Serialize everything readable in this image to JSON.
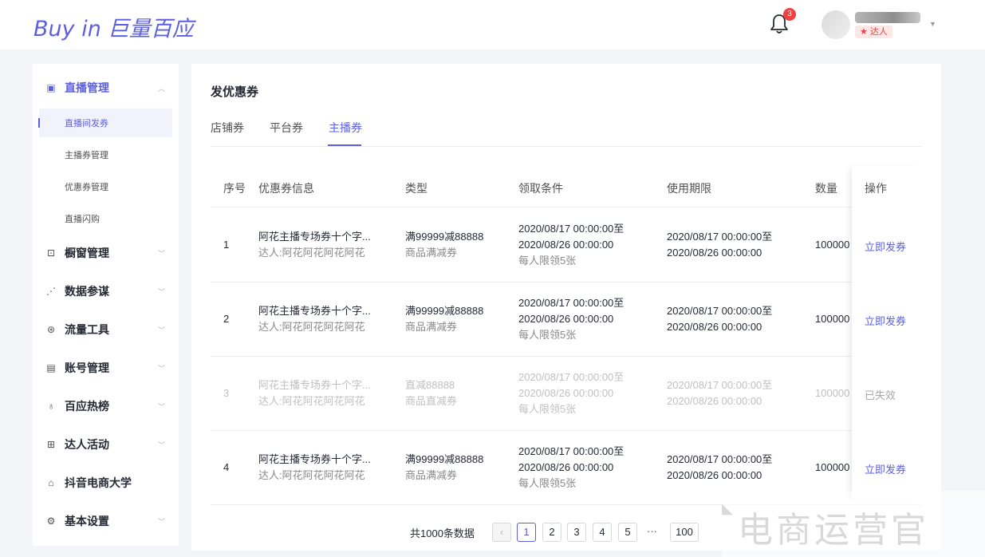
{
  "header": {
    "logo_en": "Buy in",
    "logo_cn": "巨量百应",
    "notification_count": "3",
    "user_role": "★ 达人"
  },
  "sidebar": {
    "groups": [
      {
        "label": "直播管理",
        "icon": "live-icon",
        "expanded": true
      },
      {
        "label": "橱窗管理",
        "icon": "window-icon"
      },
      {
        "label": "数据参谋",
        "icon": "chart-icon"
      },
      {
        "label": "流量工具",
        "icon": "traffic-icon"
      },
      {
        "label": "账号管理",
        "icon": "account-icon"
      },
      {
        "label": "百应热榜",
        "icon": "hot-icon"
      },
      {
        "label": "达人活动",
        "icon": "activity-icon"
      },
      {
        "label": "抖音电商大学",
        "icon": "graduation-icon"
      },
      {
        "label": "基本设置",
        "icon": "settings-icon"
      }
    ],
    "live_subitems": [
      {
        "label": "直播间发券",
        "selected": true
      },
      {
        "label": "主播券管理"
      },
      {
        "label": "优惠券管理"
      },
      {
        "label": "直播闪购"
      }
    ]
  },
  "main": {
    "title": "发优惠券",
    "tabs": [
      {
        "label": "店铺券"
      },
      {
        "label": "平台券"
      },
      {
        "label": "主播券",
        "active": true
      }
    ],
    "columns": [
      "序号",
      "优惠券信息",
      "类型",
      "领取条件",
      "使用期限",
      "数量",
      "操作"
    ],
    "rows": [
      {
        "index": "1",
        "name": "阿花主播专场券十个字...",
        "owner": "达人:阿花阿花阿花阿花",
        "type": "满99999减88888",
        "type_sub": "商品满减券",
        "cond_1": "2020/08/17 00:00:00至",
        "cond_2": "2020/08/26 00:00:00",
        "cond_3": "每人限领5张",
        "period_1": "2020/08/17 00:00:00至",
        "period_2": "2020/08/26 00:00:00",
        "qty": "100000",
        "action": "立即发券",
        "expired": false
      },
      {
        "index": "2",
        "name": "阿花主播专场券十个字...",
        "owner": "达人:阿花阿花阿花阿花",
        "type": "满99999减88888",
        "type_sub": "商品满减券",
        "cond_1": "2020/08/17 00:00:00至",
        "cond_2": "2020/08/26 00:00:00",
        "cond_3": "每人限领5张",
        "period_1": "2020/08/17 00:00:00至",
        "period_2": "2020/08/26 00:00:00",
        "qty": "100000",
        "action": "立即发券",
        "expired": false
      },
      {
        "index": "3",
        "name": "阿花主播专场券十个字...",
        "owner": "达人:阿花阿花阿花阿花",
        "type": "直减88888",
        "type_sub": "商品直减券",
        "cond_1": "2020/08/17 00:00:00至",
        "cond_2": "2020/08/26 00:00:00",
        "cond_3": "每人限领5张",
        "period_1": "2020/08/17 00:00:00至",
        "period_2": "2020/08/26 00:00:00",
        "qty": "100000",
        "action": "已失效",
        "expired": true
      },
      {
        "index": "4",
        "name": "阿花主播专场券十个字...",
        "owner": "达人:阿花阿花阿花阿花",
        "type": "满99999减88888",
        "type_sub": "商品满减券",
        "cond_1": "2020/08/17 00:00:00至",
        "cond_2": "2020/08/26 00:00:00",
        "cond_3": "每人限领5张",
        "period_1": "2020/08/17 00:00:00至",
        "period_2": "2020/08/26 00:00:00",
        "qty": "100000",
        "action": "立即发券",
        "expired": false
      }
    ],
    "pagination": {
      "total": "共1000条数据",
      "pages": [
        "1",
        "2",
        "3",
        "4",
        "5"
      ],
      "current": "1",
      "ellipsis": "···",
      "last": "100"
    }
  },
  "watermark": {
    "text": "电商运营官"
  },
  "colors": {
    "accent": "#5c5fe0",
    "badge": "#f04142",
    "page_bg": "#f4f5f8"
  }
}
